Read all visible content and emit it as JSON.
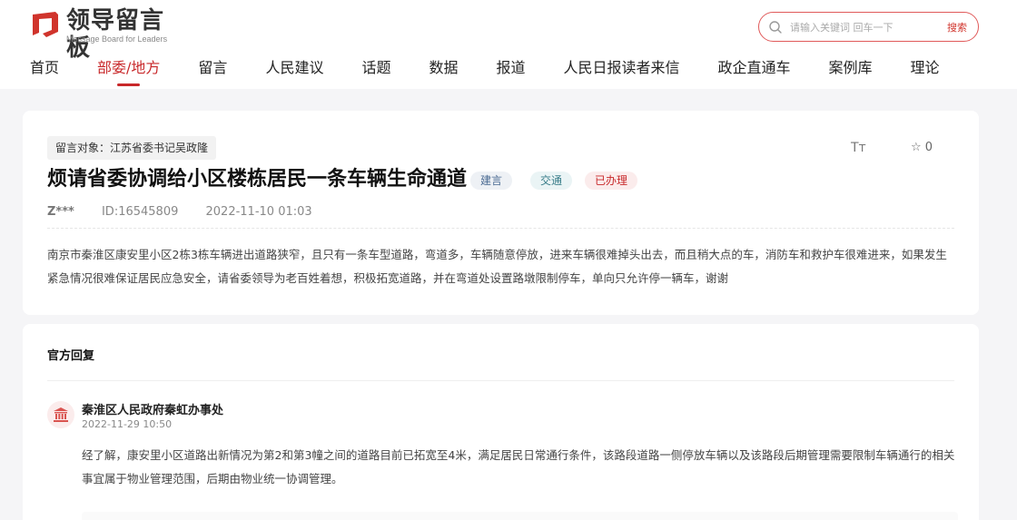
{
  "brand": {
    "name": "领导留言板",
    "subtitle": "Message Board for Leaders"
  },
  "search": {
    "placeholder": "请输入关键词 回车一下",
    "button_label": "搜索"
  },
  "nav": {
    "items": [
      {
        "label": "首页"
      },
      {
        "label": "部委/地方"
      },
      {
        "label": "留言"
      },
      {
        "label": "人民建议"
      },
      {
        "label": "话题"
      },
      {
        "label": "数据"
      },
      {
        "label": "报道"
      },
      {
        "label": "人民日报读者来信"
      },
      {
        "label": "政企直通车"
      },
      {
        "label": "案例库"
      },
      {
        "label": "理论"
      }
    ],
    "active_index": 1
  },
  "message": {
    "target": "留言对象：江苏省委书记吴政隆",
    "title": "烦请省委协调给小区楼栋居民一条车辆生命通道",
    "tags": [
      "建言",
      "交通",
      "已办理"
    ],
    "font_tool": "Tт",
    "favorite_count": "0",
    "author": "Z***",
    "id": "ID:16545809",
    "time": "2022-11-10 01:03",
    "content": "南京市秦淮区康安里小区2栋3栋车辆进出道路狭窄，且只有一条车型道路，弯道多，车辆随意停放，进来车辆很难掉头出去，而且稍大点的车，消防车和救护车很难进来，如果发生紧急情况很难保证居民应急安全，请省委领导为老百姓着想，积极拓宽道路，并在弯道处设置路墩限制停车，单向只允许停一辆车，谢谢"
  },
  "reply": {
    "heading": "官方回复",
    "org": "秦淮区人民政府秦虹办事处",
    "time": "2022-11-29 10:50",
    "content": "经了解，康安里小区道路出新情况为第2和第3幢之间的道路目前已拓宽至4米，满足居民日常通行条件，该路段道路一侧停放车辆以及该路段后期管理需要限制车辆通行的相关事宜属于物业管理范围，后期由物业统一协调管理。"
  },
  "colors": {
    "accent": "#c8282a",
    "background": "#f5f5f7"
  }
}
